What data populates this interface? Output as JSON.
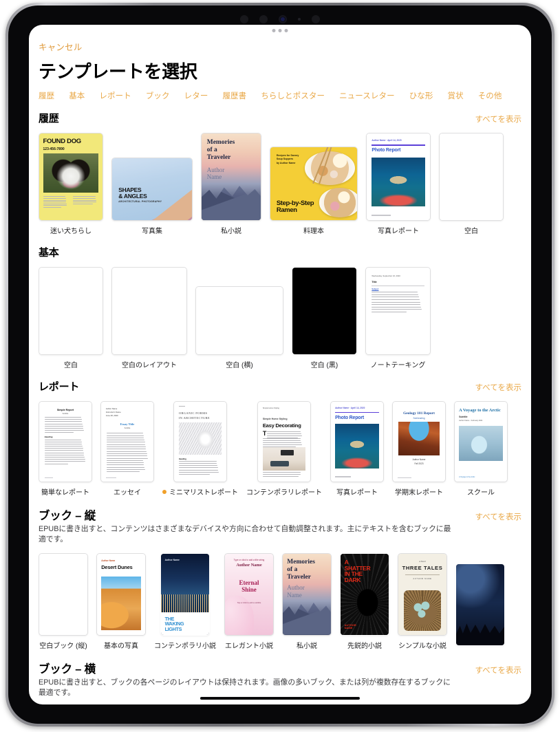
{
  "window": {
    "cancel_label": "キャンセル",
    "title": "テンプレートを選択"
  },
  "tabs": [
    {
      "label": "履歴"
    },
    {
      "label": "基本"
    },
    {
      "label": "レポート"
    },
    {
      "label": "ブック"
    },
    {
      "label": "レター"
    },
    {
      "label": "履歴書"
    },
    {
      "label": "ちらしとポスター"
    },
    {
      "label": "ニュースレター"
    },
    {
      "label": "ひな形"
    },
    {
      "label": "賞状"
    },
    {
      "label": "その他"
    }
  ],
  "see_all_label": "すべてを表示",
  "sections": [
    {
      "id": "recents",
      "title": "履歴",
      "has_see_all": true,
      "description": "",
      "items": [
        {
          "caption": "迷い犬ちらし",
          "art": "found-dog",
          "new": false,
          "art_text": {
            "title": "FOUND DOG",
            "phone": "123-456-7890"
          }
        },
        {
          "caption": "写真集",
          "art": "shapes-angles",
          "new": false,
          "art_text": {
            "title": "SHAPES\n& ANGLES",
            "subtitle": "ARCHITECTURAL PHOTOGRAPHY"
          }
        },
        {
          "caption": "私小説",
          "art": "memories",
          "new": false,
          "art_text": {
            "title": "Memories of a Traveler",
            "author": "Author Name"
          }
        },
        {
          "caption": "料理本",
          "art": "ramen",
          "new": false,
          "art_text": {
            "kicker": "Recipes for Savory\nSoup Suppers\nby Author Name",
            "title": "Step-by-Step Ramen"
          }
        },
        {
          "caption": "写真レポート",
          "art": "photo-report",
          "new": false,
          "art_text": {
            "meta": "Author Name · April 14, 2020",
            "title": "Photo Report"
          }
        },
        {
          "caption": "空白",
          "art": "blank",
          "new": false,
          "art_text": {}
        }
      ]
    },
    {
      "id": "basic",
      "title": "基本",
      "has_see_all": false,
      "description": "",
      "items": [
        {
          "caption": "空白",
          "art": "blank",
          "new": false,
          "art_text": {}
        },
        {
          "caption": "空白のレイアウト",
          "art": "blank",
          "new": false,
          "art_text": {}
        },
        {
          "caption": "空白 (横)",
          "art": "blank-landscape",
          "new": false,
          "art_text": {}
        },
        {
          "caption": "空白 (黒)",
          "art": "black",
          "new": false,
          "art_text": {}
        },
        {
          "caption": "ノートテーキング",
          "art": "note-taking",
          "new": false,
          "art_text": {
            "meta": "Wednesday, September 16, 2020",
            "title": "Title",
            "sub": "Subject"
          }
        }
      ]
    },
    {
      "id": "reports",
      "title": "レポート",
      "has_see_all": true,
      "description": "",
      "items": [
        {
          "caption": "簡単なレポート",
          "art": "simple-report",
          "new": false,
          "art_text": {
            "title": "Simple Report",
            "sub": "Subtitle",
            "heading": "Heading"
          }
        },
        {
          "caption": "エッセイ",
          "art": "essay",
          "new": false,
          "art_text": {
            "meta": "Author Name\nInstructor's Name\nJune 28, 2020",
            "title": "Essay Title",
            "sub": "Subtitle"
          }
        },
        {
          "caption": "ミニマリストレポート",
          "art": "organic-forms",
          "new": true,
          "art_text": {
            "title": "ORGANIC FORMS IN ARCHITECTURE",
            "heading": "Heading"
          }
        },
        {
          "caption": "コンテンポラリレポート",
          "art": "easy-decorating",
          "new": false,
          "art_text": {
            "kicker": "Simple Home Styling",
            "title": "Easy Decorating",
            "dropcap": "T"
          }
        },
        {
          "caption": "写真レポート",
          "art": "photo-report",
          "new": false,
          "art_text": {
            "meta": "Author Name · April 14, 2020",
            "title": "Photo Report"
          }
        },
        {
          "caption": "学期末レポート",
          "art": "geology",
          "new": false,
          "art_text": {
            "title": "Geology 101 Report",
            "sub": "Subheading",
            "author": "Author Name",
            "term": "Fall 2023"
          }
        },
        {
          "caption": "スクール",
          "art": "voyage",
          "new": false,
          "art_text": {
            "title": "A Voyage to the Arctic",
            "sub": "Subtitle",
            "meta": "Author Name · February 2021"
          }
        }
      ]
    },
    {
      "id": "books-portrait",
      "title": "ブック – 縦",
      "has_see_all": true,
      "description": "EPUBに書き出すと、コンテンツはさまざまなデバイスや方向に合わせて自動調整されます。主にテキストを含むブックに最適です。",
      "items": [
        {
          "caption": "空白ブック (縦)",
          "art": "blank",
          "new": false,
          "art_text": {}
        },
        {
          "caption": "基本の写真",
          "art": "desert-dunes",
          "new": false,
          "art_text": {
            "author": "Author Name",
            "title": "Desert Dunes"
          }
        },
        {
          "caption": "コンテンポラリ小説",
          "art": "waking-lights",
          "new": false,
          "art_text": {
            "author": "Author Name",
            "title": "THE WAKING LIGHTS"
          }
        },
        {
          "caption": "エレガント小説",
          "art": "eternal-shine",
          "new": false,
          "art_text": {
            "top": "Type or click to add a title string",
            "author": "Author Name",
            "title": "Eternal Shine",
            "sub": "Tap or click to add a subtitle"
          }
        },
        {
          "caption": "私小説",
          "art": "memories",
          "new": false,
          "art_text": {
            "title": "Memories of a Traveler",
            "author": "Author Name"
          }
        },
        {
          "caption": "先鋭的小説",
          "art": "shatter",
          "new": false,
          "art_text": {
            "title": "A SHATTER IN THE DARK",
            "author": "AUTHOR NAME"
          }
        },
        {
          "caption": "シンプルな小説",
          "art": "three-tales",
          "new": false,
          "art_text": {
            "kicker": "A Novel",
            "title": "THREE TALES",
            "author": "AUTHOR NAME"
          }
        },
        {
          "caption": "",
          "art": "night-book",
          "new": false,
          "art_text": {}
        }
      ]
    },
    {
      "id": "books-landscape",
      "title": "ブック – 横",
      "has_see_all": true,
      "description": "EPUBに書き出すと、ブックの各ページのレイアウトは保持されます。画像の多いブック、または列が複数存在するブックに最適です。",
      "items": []
    }
  ],
  "colors": {
    "accent": "#e9a94a",
    "new_dot": "#f0a02a",
    "text": "#1c1c1e"
  }
}
